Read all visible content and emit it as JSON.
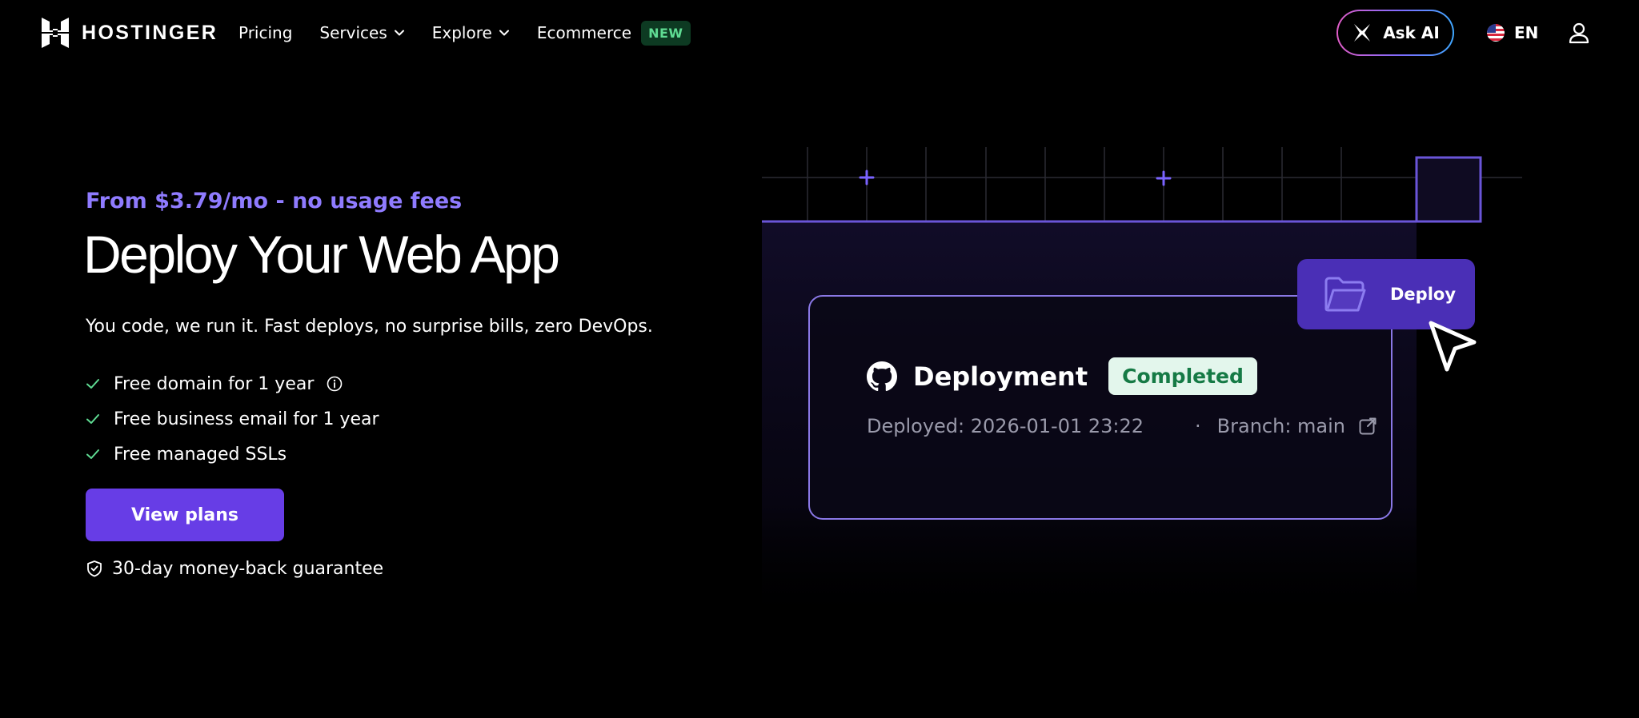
{
  "brand": {
    "name": "HOSTINGER"
  },
  "nav": {
    "items": [
      {
        "label": "Pricing",
        "dropdown": false
      },
      {
        "label": "Services",
        "dropdown": true
      },
      {
        "label": "Explore",
        "dropdown": true
      },
      {
        "label": "Ecommerce",
        "dropdown": false,
        "badge": "NEW"
      }
    ]
  },
  "header": {
    "ask_ai_label": "Ask AI",
    "language": "EN"
  },
  "hero": {
    "price_text": "From $3.79/mo - no usage fees",
    "title": "Deploy Your Web App",
    "subtitle": "You code, we run it. Fast deploys, no surprise bills, zero DevOps.",
    "features": [
      "Free domain for 1 year",
      "Free business email for 1 year",
      "Free managed SSLs"
    ],
    "cta_label": "View plans",
    "guarantee": "30-day money-back guarantee"
  },
  "illustration": {
    "card_title": "Deployment",
    "status_badge": "Completed",
    "deployed_text": "Deployed: 2026-01-01 23:22",
    "separator": "·",
    "branch_text": "Branch: main",
    "deploy_button_label": "Deploy"
  },
  "colors": {
    "accent": "#673de6",
    "price_text": "#8f7bff",
    "check": "#5fdc93",
    "badge_new_bg": "#0d3a22",
    "completed_bg": "#e3f6ec",
    "completed_text": "#157a45",
    "deploy_button_bg": "#4a2fb6"
  },
  "icons": {
    "logo": "hostinger-logo-icon",
    "ask_ai": "sparkle-icon",
    "language": "us-flag-icon",
    "account": "user-icon",
    "feature": "check-icon",
    "info": "info-icon",
    "guarantee": "shield-check-icon",
    "repo": "github-icon",
    "branch_link": "external-link-icon",
    "deploy": "folder-icon",
    "pointer": "cursor-arrow-icon"
  }
}
